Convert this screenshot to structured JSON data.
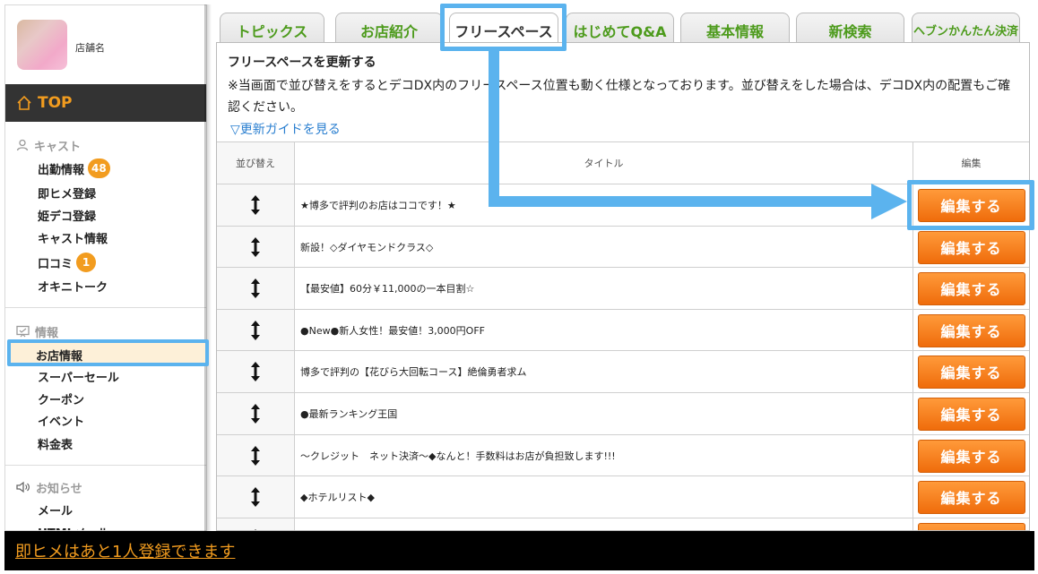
{
  "sidebar": {
    "shop_name": "店舗名",
    "top_label": "TOP",
    "cast_section": {
      "heading": "キャスト",
      "items": [
        {
          "label": "出勤情報",
          "badge": "48"
        },
        {
          "label": "即ヒメ登録"
        },
        {
          "label": "姫デコ登録"
        },
        {
          "label": "キャスト情報"
        },
        {
          "label": "口コミ",
          "badge": "1"
        },
        {
          "label": "オキニトーク"
        }
      ]
    },
    "info_section": {
      "heading": "情報",
      "items": [
        {
          "label": "お店情報",
          "active": true
        },
        {
          "label": "スーパーセール"
        },
        {
          "label": "クーポン"
        },
        {
          "label": "イベント"
        },
        {
          "label": "料金表"
        }
      ]
    },
    "notice_section": {
      "heading": "お知らせ",
      "items": [
        {
          "label": "メール"
        },
        {
          "label": "HTMLメール"
        }
      ]
    }
  },
  "tabs": [
    {
      "label": "トピックス"
    },
    {
      "label": "お店紹介"
    },
    {
      "label": "フリースペース",
      "active": true
    },
    {
      "label": "はじめてQ&A"
    },
    {
      "label": "基本情報"
    },
    {
      "label": "新検索"
    },
    {
      "label": "ヘブンかんたん決済"
    }
  ],
  "panel": {
    "title": "フリースペースを更新する",
    "note": "※当画面で並び替えをするとデコDX内のフリースペース位置も動く仕様となっております。並び替えをした場合は、デコDX内の配置もご確認ください。",
    "guide_link": "▽更新ガイドを見る"
  },
  "table": {
    "headers": {
      "sort": "並び替え",
      "title": "タイトル",
      "edit": "編集"
    },
    "edit_button_label": "編集する",
    "rows": [
      {
        "title": "★博多で評判のお店はココです！★"
      },
      {
        "title": "新設！◇ダイヤモンドクラス◇"
      },
      {
        "title": "【最安値】60分￥11,000の一本目割☆"
      },
      {
        "title": "●New●新人女性！最安値！3,000円OFF"
      },
      {
        "title": "博多で評判の【花びら大回転コース】絶倫勇者求ム"
      },
      {
        "title": "●最新ランキング王国"
      },
      {
        "title": "～クレジット　ネット決済～◆なんと！手数料はお店が負担致します!!!"
      },
      {
        "title": "◆ホテルリスト◆"
      },
      {
        "title": ""
      }
    ]
  },
  "footer": {
    "message": "即ヒメはあと1人登録できます"
  },
  "colors": {
    "accent_orange": "#f29c1f",
    "tab_green": "#4d9b1c",
    "highlight_blue": "#5bb3ee",
    "button_orange": "#ef6c0b"
  }
}
